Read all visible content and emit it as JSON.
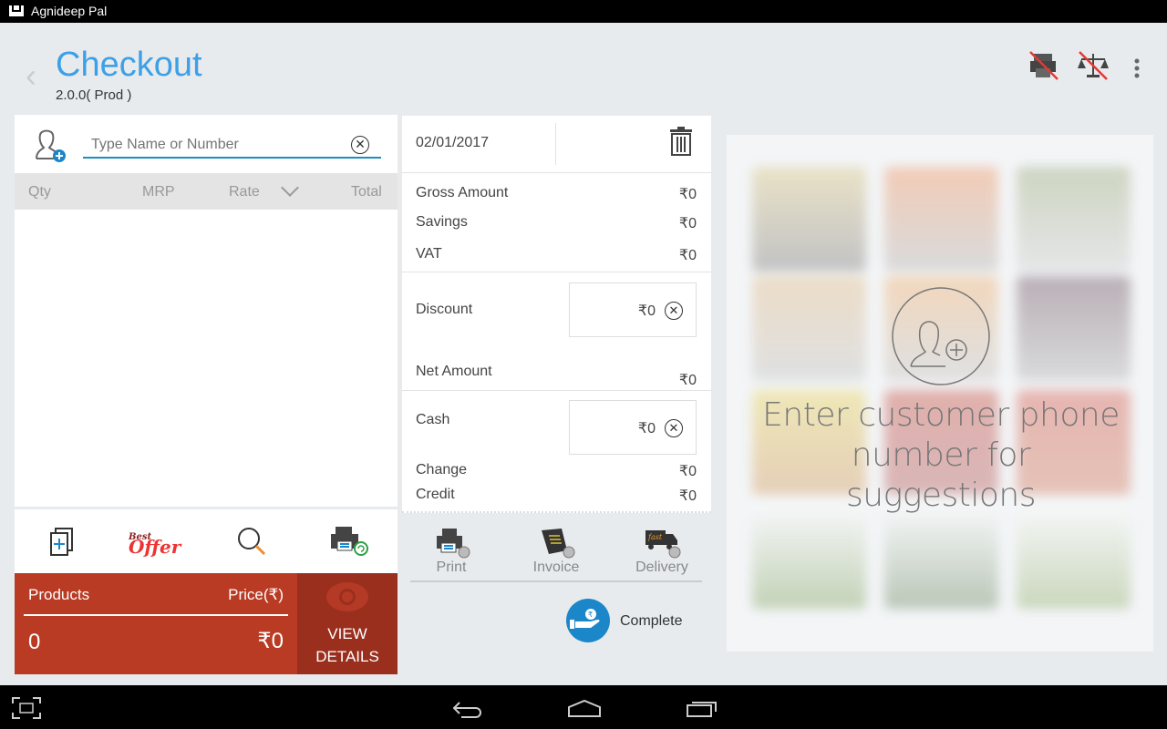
{
  "status_bar": {
    "user": "Agnideep Pal",
    "icon": "gmail-icon"
  },
  "header": {
    "title": "Checkout",
    "version": "2.0.0( Prod )",
    "icons": [
      "printer-disabled-icon",
      "scale-disabled-icon",
      "overflow-menu-icon"
    ]
  },
  "customer": {
    "placeholder": "Type Name or Number"
  },
  "table": {
    "headers": [
      "Qty",
      "MRP",
      "Rate",
      "Total"
    ]
  },
  "toolbar": [
    "add-item-icon",
    "best-offer-icon",
    "search-icon",
    "reprint-icon"
  ],
  "summary": {
    "products_label": "Products",
    "price_label": "Price(₹)",
    "products": "0",
    "price": "₹0",
    "view_details": "VIEW DETAILS"
  },
  "bill": {
    "date": "02/01/2017",
    "gross_label": "Gross Amount",
    "gross": "₹0",
    "savings_label": "Savings",
    "savings": "₹0",
    "vat_label": "VAT",
    "vat": "₹0",
    "discount_label": "Discount",
    "discount": "₹0",
    "net_label": "Net Amount",
    "net": "₹0",
    "cash_label": "Cash",
    "cash": "₹0",
    "change_label": "Change",
    "change": "₹0",
    "credit_label": "Credit",
    "credit": "₹0"
  },
  "actions": {
    "print": "Print",
    "invoice": "Invoice",
    "delivery": "Delivery",
    "complete": "Complete"
  },
  "suggestions": {
    "message": "Enter customer phone number for suggestions"
  },
  "colors": {
    "accent": "#3da0e6",
    "summary_red": "#ba3b24",
    "summary_dark": "#9a2f1e",
    "complete_blue": "#1b87c9"
  }
}
